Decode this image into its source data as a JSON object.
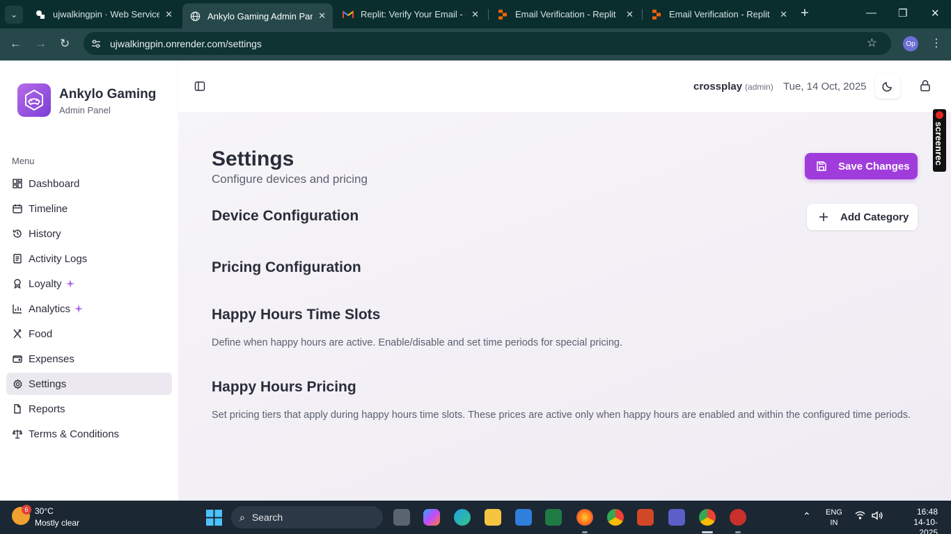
{
  "browser": {
    "tabs": [
      {
        "label": "ujwalkingpin · Web Service",
        "icon": "render-icon"
      },
      {
        "label": "Ankylo Gaming Admin Panel",
        "icon": "globe-icon"
      },
      {
        "label": "Replit: Verify Your Email - op",
        "icon": "gmail-icon"
      },
      {
        "label": "Email Verification - Replit",
        "icon": "replit-icon"
      },
      {
        "label": "Email Verification - Replit",
        "icon": "replit-icon"
      }
    ],
    "url": "ujwalkingpin.onrender.com/settings",
    "profile_initials": "Op"
  },
  "sidebar": {
    "brand_title": "Ankylo Gaming",
    "brand_subtitle": "Admin Panel",
    "menu_label": "Menu",
    "items": [
      {
        "label": "Dashboard",
        "icon": "dashboard-icon"
      },
      {
        "label": "Timeline",
        "icon": "calendar-icon"
      },
      {
        "label": "History",
        "icon": "history-icon"
      },
      {
        "label": "Activity Logs",
        "icon": "logs-icon"
      },
      {
        "label": "Loyalty",
        "icon": "award-icon"
      },
      {
        "label": "Analytics",
        "icon": "chart-icon"
      },
      {
        "label": "Food",
        "icon": "utensils-icon"
      },
      {
        "label": "Expenses",
        "icon": "wallet-icon"
      },
      {
        "label": "Settings",
        "icon": "gear-icon"
      },
      {
        "label": "Reports",
        "icon": "file-icon"
      },
      {
        "label": "Terms & Conditions",
        "icon": "scale-icon"
      }
    ],
    "active_item": "Settings",
    "accent_color": "#a13cdc"
  },
  "header": {
    "username": "crossplay",
    "role": "(admin)",
    "date": "Tue, 14 Oct, 2025"
  },
  "main": {
    "title": "Settings",
    "subtitle": "Configure devices and pricing",
    "save_label": "Save Changes",
    "add_category_label": "Add Category",
    "sections": {
      "device": {
        "title": "Device Configuration"
      },
      "pricing": {
        "title": "Pricing Configuration"
      },
      "happy_slots": {
        "title": "Happy Hours Time Slots",
        "description": "Define when happy hours are active. Enable/disable and set time periods for special pricing."
      },
      "happy_pricing": {
        "title": "Happy Hours Pricing",
        "description": "Set pricing tiers that apply during happy hours time slots. These prices are active only when happy hours are enabled and within the configured time periods."
      }
    }
  },
  "overlay": {
    "screenrec_label": "screenrec"
  },
  "taskbar": {
    "weather_temp": "30°C",
    "weather_desc": "Mostly clear",
    "weather_badge": "6",
    "search_label": "Search",
    "lang_line1": "ENG",
    "lang_line2": "IN",
    "time": "16:48",
    "date": "14-10-2025"
  }
}
